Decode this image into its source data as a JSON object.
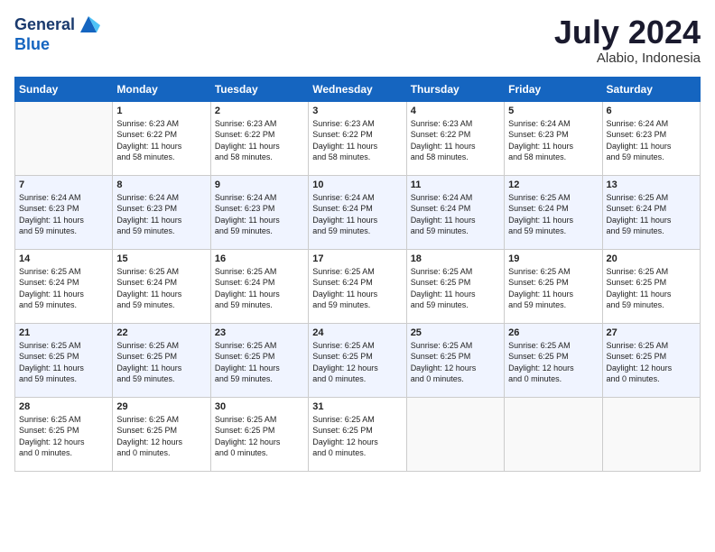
{
  "header": {
    "logo_line1": "General",
    "logo_line2": "Blue",
    "month": "July 2024",
    "location": "Alabio, Indonesia"
  },
  "days_of_week": [
    "Sunday",
    "Monday",
    "Tuesday",
    "Wednesday",
    "Thursday",
    "Friday",
    "Saturday"
  ],
  "weeks": [
    [
      {
        "day": "",
        "info": ""
      },
      {
        "day": "1",
        "info": "Sunrise: 6:23 AM\nSunset: 6:22 PM\nDaylight: 11 hours\nand 58 minutes."
      },
      {
        "day": "2",
        "info": "Sunrise: 6:23 AM\nSunset: 6:22 PM\nDaylight: 11 hours\nand 58 minutes."
      },
      {
        "day": "3",
        "info": "Sunrise: 6:23 AM\nSunset: 6:22 PM\nDaylight: 11 hours\nand 58 minutes."
      },
      {
        "day": "4",
        "info": "Sunrise: 6:23 AM\nSunset: 6:22 PM\nDaylight: 11 hours\nand 58 minutes."
      },
      {
        "day": "5",
        "info": "Sunrise: 6:24 AM\nSunset: 6:23 PM\nDaylight: 11 hours\nand 58 minutes."
      },
      {
        "day": "6",
        "info": "Sunrise: 6:24 AM\nSunset: 6:23 PM\nDaylight: 11 hours\nand 59 minutes."
      }
    ],
    [
      {
        "day": "7",
        "info": "Sunrise: 6:24 AM\nSunset: 6:23 PM\nDaylight: 11 hours\nand 59 minutes."
      },
      {
        "day": "8",
        "info": "Sunrise: 6:24 AM\nSunset: 6:23 PM\nDaylight: 11 hours\nand 59 minutes."
      },
      {
        "day": "9",
        "info": "Sunrise: 6:24 AM\nSunset: 6:23 PM\nDaylight: 11 hours\nand 59 minutes."
      },
      {
        "day": "10",
        "info": "Sunrise: 6:24 AM\nSunset: 6:24 PM\nDaylight: 11 hours\nand 59 minutes."
      },
      {
        "day": "11",
        "info": "Sunrise: 6:24 AM\nSunset: 6:24 PM\nDaylight: 11 hours\nand 59 minutes."
      },
      {
        "day": "12",
        "info": "Sunrise: 6:25 AM\nSunset: 6:24 PM\nDaylight: 11 hours\nand 59 minutes."
      },
      {
        "day": "13",
        "info": "Sunrise: 6:25 AM\nSunset: 6:24 PM\nDaylight: 11 hours\nand 59 minutes."
      }
    ],
    [
      {
        "day": "14",
        "info": "Sunrise: 6:25 AM\nSunset: 6:24 PM\nDaylight: 11 hours\nand 59 minutes."
      },
      {
        "day": "15",
        "info": "Sunrise: 6:25 AM\nSunset: 6:24 PM\nDaylight: 11 hours\nand 59 minutes."
      },
      {
        "day": "16",
        "info": "Sunrise: 6:25 AM\nSunset: 6:24 PM\nDaylight: 11 hours\nand 59 minutes."
      },
      {
        "day": "17",
        "info": "Sunrise: 6:25 AM\nSunset: 6:24 PM\nDaylight: 11 hours\nand 59 minutes."
      },
      {
        "day": "18",
        "info": "Sunrise: 6:25 AM\nSunset: 6:25 PM\nDaylight: 11 hours\nand 59 minutes."
      },
      {
        "day": "19",
        "info": "Sunrise: 6:25 AM\nSunset: 6:25 PM\nDaylight: 11 hours\nand 59 minutes."
      },
      {
        "day": "20",
        "info": "Sunrise: 6:25 AM\nSunset: 6:25 PM\nDaylight: 11 hours\nand 59 minutes."
      }
    ],
    [
      {
        "day": "21",
        "info": "Sunrise: 6:25 AM\nSunset: 6:25 PM\nDaylight: 11 hours\nand 59 minutes."
      },
      {
        "day": "22",
        "info": "Sunrise: 6:25 AM\nSunset: 6:25 PM\nDaylight: 11 hours\nand 59 minutes."
      },
      {
        "day": "23",
        "info": "Sunrise: 6:25 AM\nSunset: 6:25 PM\nDaylight: 11 hours\nand 59 minutes."
      },
      {
        "day": "24",
        "info": "Sunrise: 6:25 AM\nSunset: 6:25 PM\nDaylight: 12 hours\nand 0 minutes."
      },
      {
        "day": "25",
        "info": "Sunrise: 6:25 AM\nSunset: 6:25 PM\nDaylight: 12 hours\nand 0 minutes."
      },
      {
        "day": "26",
        "info": "Sunrise: 6:25 AM\nSunset: 6:25 PM\nDaylight: 12 hours\nand 0 minutes."
      },
      {
        "day": "27",
        "info": "Sunrise: 6:25 AM\nSunset: 6:25 PM\nDaylight: 12 hours\nand 0 minutes."
      }
    ],
    [
      {
        "day": "28",
        "info": "Sunrise: 6:25 AM\nSunset: 6:25 PM\nDaylight: 12 hours\nand 0 minutes."
      },
      {
        "day": "29",
        "info": "Sunrise: 6:25 AM\nSunset: 6:25 PM\nDaylight: 12 hours\nand 0 minutes."
      },
      {
        "day": "30",
        "info": "Sunrise: 6:25 AM\nSunset: 6:25 PM\nDaylight: 12 hours\nand 0 minutes."
      },
      {
        "day": "31",
        "info": "Sunrise: 6:25 AM\nSunset: 6:25 PM\nDaylight: 12 hours\nand 0 minutes."
      },
      {
        "day": "",
        "info": ""
      },
      {
        "day": "",
        "info": ""
      },
      {
        "day": "",
        "info": ""
      }
    ]
  ]
}
